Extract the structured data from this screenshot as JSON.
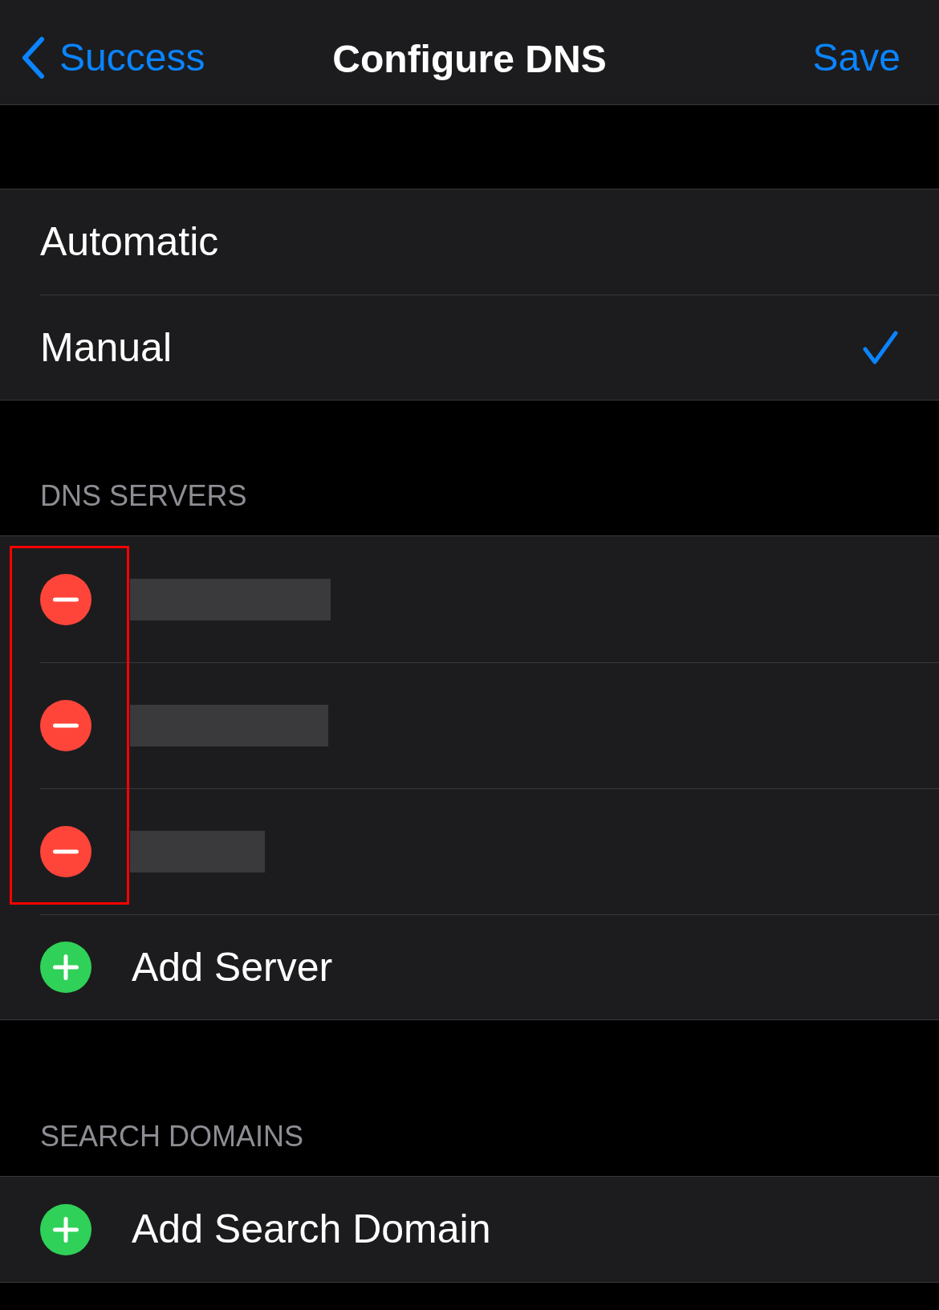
{
  "nav": {
    "back": "Success",
    "title": "Configure DNS",
    "action": "Save"
  },
  "options": [
    {
      "label": "Automatic",
      "selected": false
    },
    {
      "label": "Manual",
      "selected": true
    }
  ],
  "dns_servers": {
    "header": "DNS SERVERS",
    "highlight_frame": true,
    "servers": [
      {
        "kind": "redacted"
      },
      {
        "kind": "redacted"
      },
      {
        "kind": "redacted"
      }
    ],
    "add": "Add Server"
  },
  "search_domains": {
    "header": "SEARCH DOMAINS",
    "add": "Add Search Domain"
  }
}
